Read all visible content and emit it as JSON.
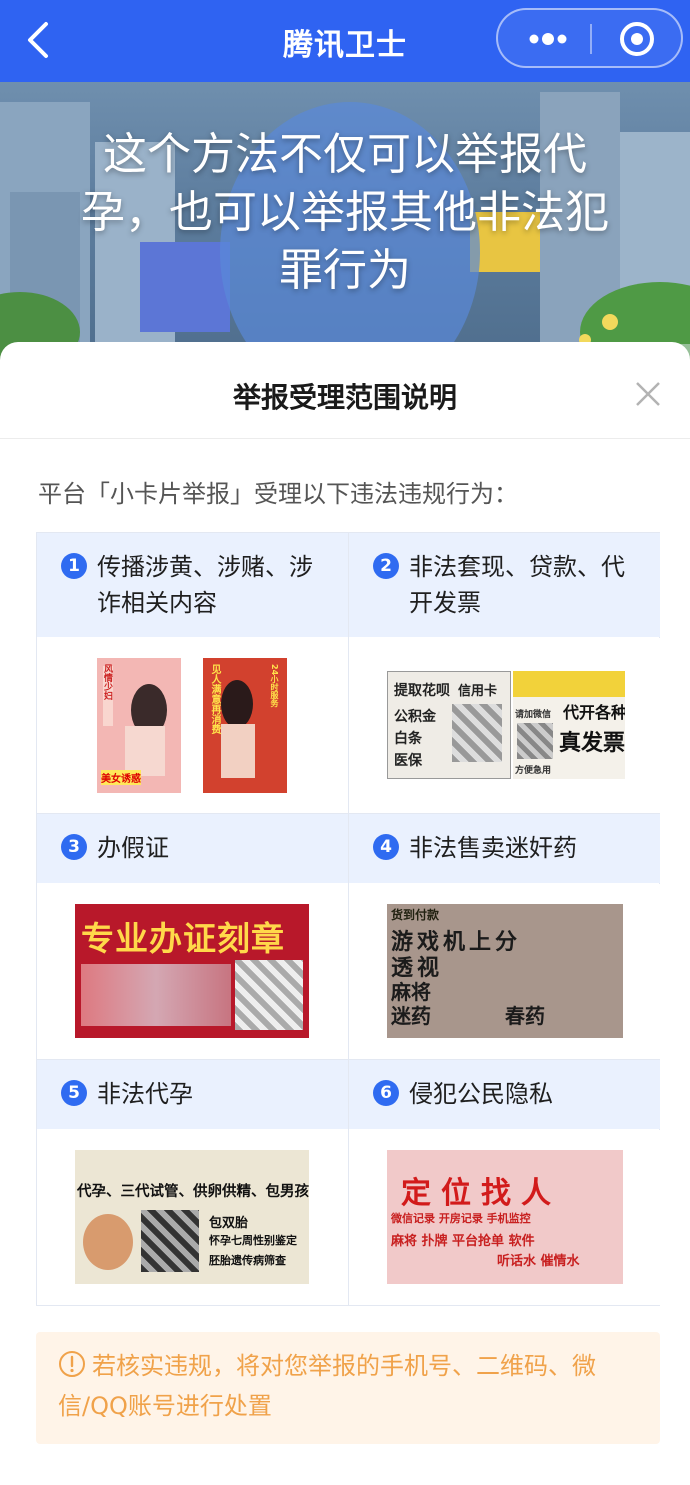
{
  "navbar": {
    "title": "腾讯卫士",
    "back_icon": "chevron-left-icon",
    "more_icon": "more-dots-icon",
    "close_icon": "target-circle-icon",
    "color": "#2f63f2"
  },
  "hero": {
    "headline": "这个方法不仅可以举报代孕，也可以举报其他非法犯罪行为"
  },
  "sheet": {
    "title": "举报受理范围说明",
    "close_icon": "close-icon",
    "intro": "平台「小卡片举报」受理以下违法违规行为："
  },
  "categories": [
    {
      "num": "1",
      "label_line1": "传播涉黄、涉赌、涉",
      "label_line2": "诈相关内容",
      "card_a": {
        "t1": "风情少妇",
        "t2": "美女诱惑"
      },
      "card_b": {
        "t1": "见人满意再消费",
        "t2": "24小时服务"
      }
    },
    {
      "num": "2",
      "label_line1": "非法套现、贷款、代",
      "label_line2": "开发票",
      "card_a": {
        "t1": "提取花呗",
        "t2": "信用卡",
        "t3": "公积金",
        "t4": "白条",
        "t5": "医保"
      },
      "card_b": {
        "t1": "代开各种",
        "t2": "真发票",
        "t3": "请加微信",
        "t4": "方便急用"
      }
    },
    {
      "num": "3",
      "label_line1": "办假证",
      "card_a": {
        "t1": "专业办证刻章"
      }
    },
    {
      "num": "4",
      "label_line1": "非法售卖迷奸药",
      "card_a": {
        "t1": "货到付款",
        "t2": "游戏机上分",
        "t3": "透视",
        "t4": "麻将",
        "t5": "迷药",
        "t6": "春药"
      }
    },
    {
      "num": "5",
      "label_line1": "非法代孕",
      "card_a": {
        "t1": "代孕、三代试管、供卵供精、包男孩",
        "t2": "包双胎",
        "t3": "怀孕七周性别鉴定",
        "t4": "胚胎遗传病筛查"
      }
    },
    {
      "num": "6",
      "label_line1": "侵犯公民隐私",
      "card_a": {
        "t1": "定位找人",
        "t2": "微信记录 开房记录 手机监控",
        "t3": "麻将 扑牌 平台抢单 软件",
        "t4": "听话水 催情水"
      }
    }
  ],
  "notice": {
    "icon": "info-circle-icon",
    "text": "若核实违规，将对您举报的手机号、二维码、微信/QQ账号进行处置",
    "color": "#f0a24a"
  }
}
